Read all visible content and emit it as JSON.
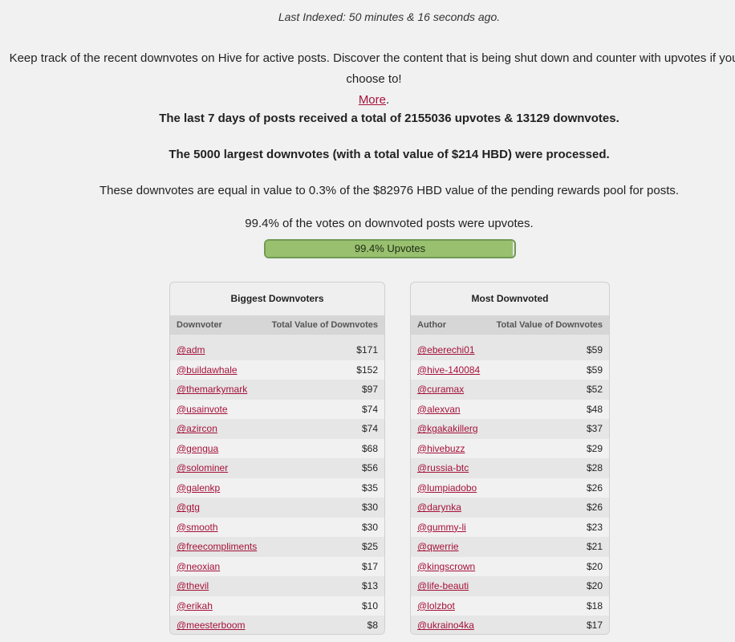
{
  "header": {
    "last_indexed": "Last Indexed: 50 minutes & 16 seconds ago.",
    "intro_text": "Keep track of the recent downvotes on Hive for active posts. Discover the content that is being shut down and counter with upvotes if you choose to!",
    "more_link": "More",
    "more_suffix": "."
  },
  "stats": {
    "summary": "The last 7 days of posts received a total of 2155036 upvotes & 13129 downvotes.",
    "processed": "The 5000 largest downvotes (with a total value of $214 HBD) were processed.",
    "pool_share": "These downvotes are equal in value to 0.3% of the $82976 HBD value of the pending rewards pool for posts.",
    "upvote_share": "99.4% of the votes on downvoted posts were upvotes."
  },
  "progress": {
    "label": "99.4% Upvotes",
    "percent": 99.4,
    "fill_color": "#98c06f"
  },
  "downvoters": {
    "title": "Biggest Downvoters",
    "columns": [
      "Downvoter",
      "Total Value of Downvotes"
    ],
    "rows": [
      {
        "name": "@adm",
        "value": "$171"
      },
      {
        "name": "@buildawhale",
        "value": "$152"
      },
      {
        "name": "@themarkymark",
        "value": "$97"
      },
      {
        "name": "@usainvote",
        "value": "$74"
      },
      {
        "name": "@azircon",
        "value": "$74"
      },
      {
        "name": "@gengua",
        "value": "$68"
      },
      {
        "name": "@solominer",
        "value": "$56"
      },
      {
        "name": "@galenkp",
        "value": "$35"
      },
      {
        "name": "@gtg",
        "value": "$30"
      },
      {
        "name": "@smooth",
        "value": "$30"
      },
      {
        "name": "@freecompliments",
        "value": "$25"
      },
      {
        "name": "@neoxian",
        "value": "$17"
      },
      {
        "name": "@thevil",
        "value": "$13"
      },
      {
        "name": "@erikah",
        "value": "$10"
      },
      {
        "name": "@meesterboom",
        "value": "$8"
      }
    ]
  },
  "downvoted": {
    "title": "Most Downvoted",
    "columns": [
      "Author",
      "Total Value of Downvotes"
    ],
    "rows": [
      {
        "name": "@eberechi01",
        "value": "$59"
      },
      {
        "name": "@hive-140084",
        "value": "$59"
      },
      {
        "name": "@curamax",
        "value": "$52"
      },
      {
        "name": "@alexvan",
        "value": "$48"
      },
      {
        "name": "@kgakakillerg",
        "value": "$37"
      },
      {
        "name": "@hivebuzz",
        "value": "$29"
      },
      {
        "name": "@russia-btc",
        "value": "$28"
      },
      {
        "name": "@lumpiadobo",
        "value": "$26"
      },
      {
        "name": "@darynka",
        "value": "$26"
      },
      {
        "name": "@gummy-li",
        "value": "$23"
      },
      {
        "name": "@qwerrie",
        "value": "$21"
      },
      {
        "name": "@kingscrown",
        "value": "$20"
      },
      {
        "name": "@life-beauti",
        "value": "$20"
      },
      {
        "name": "@lolzbot",
        "value": "$18"
      },
      {
        "name": "@ukraino4ka",
        "value": "$17"
      }
    ]
  },
  "colors": {
    "link": "#a5123a",
    "background": "#f1f1f1",
    "header_row": "#d6d6d6"
  }
}
